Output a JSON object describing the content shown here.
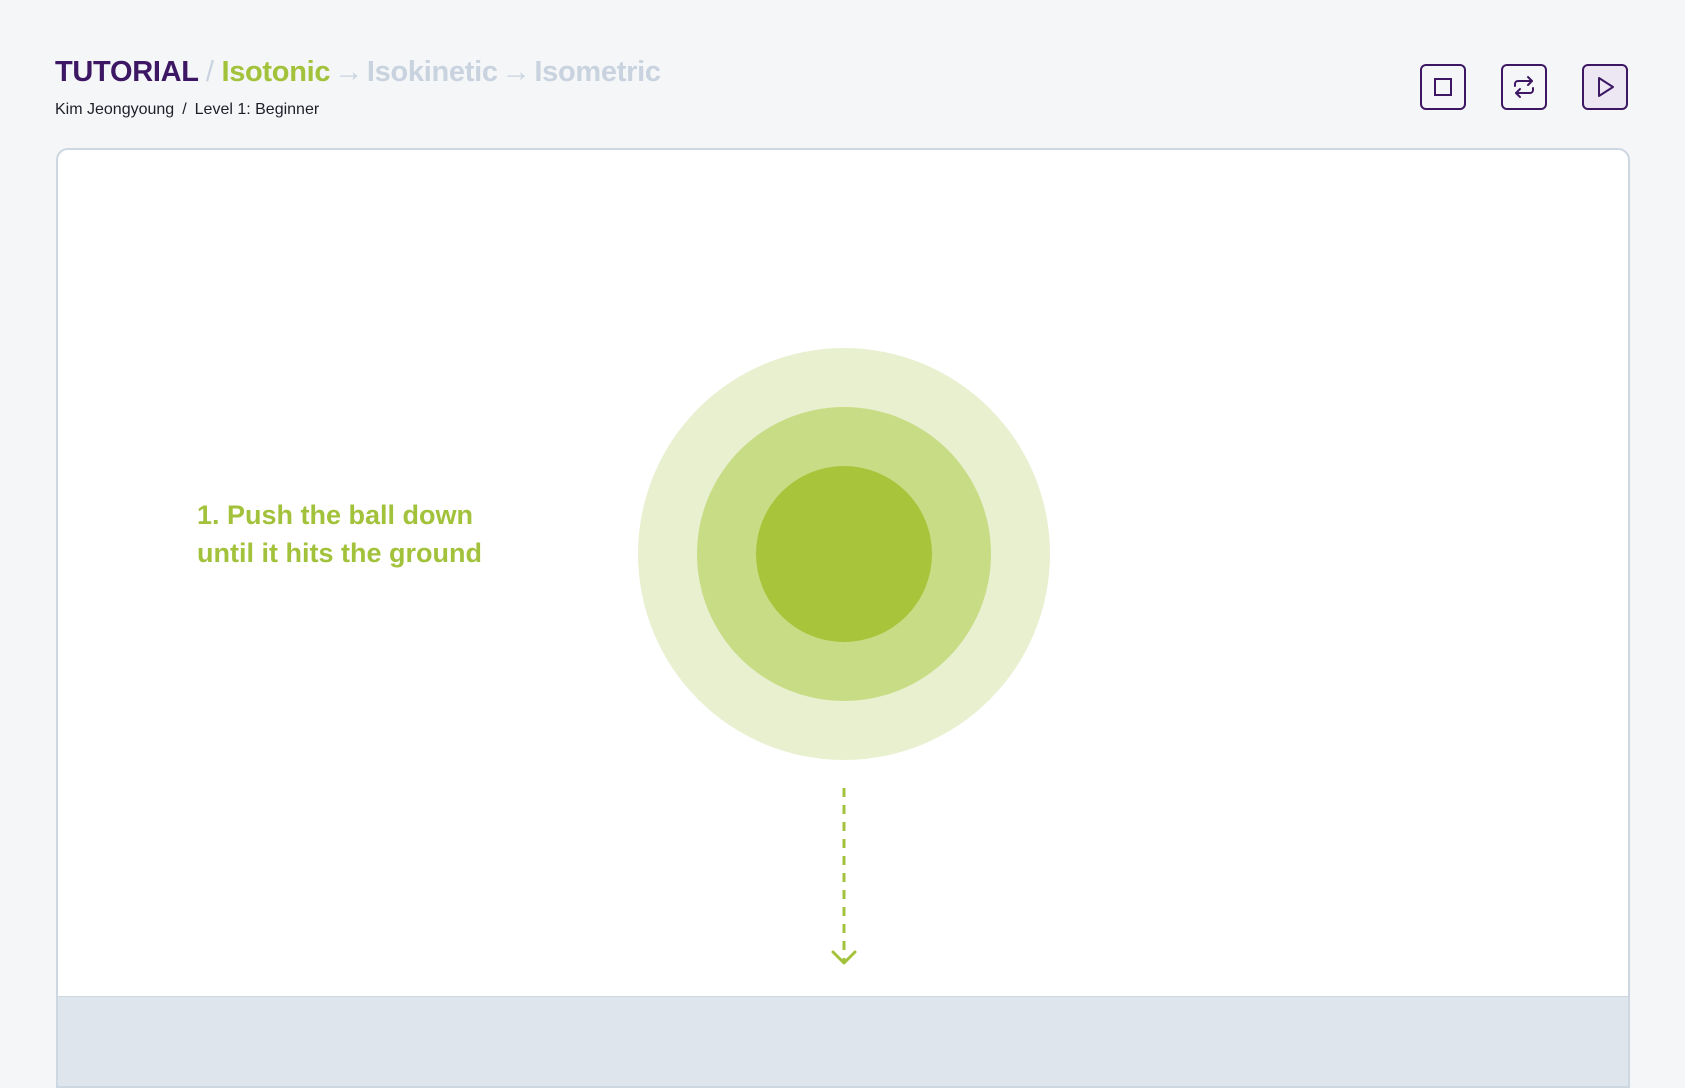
{
  "header": {
    "root": "TUTORIAL",
    "separator": "/",
    "steps": [
      "Isotonic",
      "Isokinetic",
      "Isometric"
    ],
    "arrow": "→",
    "user_name": "Kim Jeongyoung",
    "subline_separator": "/",
    "level": "Level 1: Beginner"
  },
  "controls": [
    {
      "name": "stop-button",
      "icon": "stop-icon"
    },
    {
      "name": "repeat-button",
      "icon": "repeat-icon"
    },
    {
      "name": "play-button",
      "icon": "play-icon",
      "active": true
    }
  ],
  "instruction": {
    "line1": "1. Push the ball down",
    "line2": "until it hits the ground"
  },
  "colors": {
    "brand": "#3d1764",
    "accent": "#a3c23b",
    "inactive": "#c9d3df",
    "ground": "#dfe5ed"
  }
}
